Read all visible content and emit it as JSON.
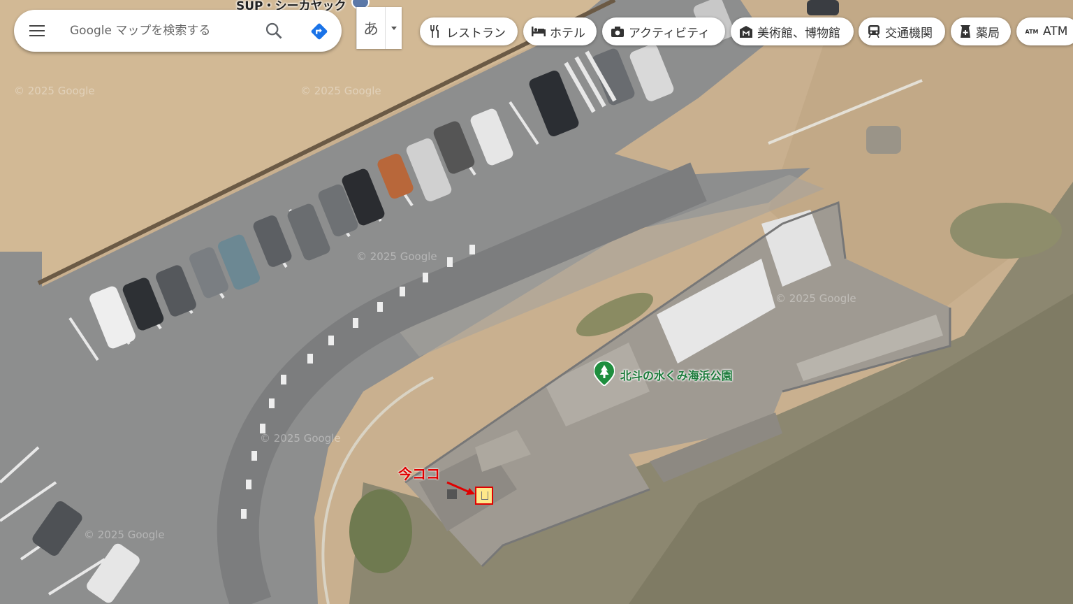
{
  "search": {
    "placeholder": "Google マップを検索する",
    "menu_icon": "hamburger-menu-icon",
    "search_icon": "magnifier-icon",
    "directions_icon": "directions-arrow-icon",
    "accent_color": "#1a73e8"
  },
  "ime": {
    "label": "あ"
  },
  "chips": [
    {
      "label": "レストラン",
      "icon": "restaurant-icon"
    },
    {
      "label": "ホテル",
      "icon": "hotel-bed-icon"
    },
    {
      "label": "アクティビティ",
      "icon": "camera-icon"
    },
    {
      "label": "美術館、博物館",
      "icon": "museum-icon"
    },
    {
      "label": "交通機関",
      "icon": "train-icon"
    },
    {
      "label": "薬局",
      "icon": "pharmacy-icon"
    },
    {
      "label": "ATM",
      "icon": "atm-icon"
    }
  ],
  "map": {
    "top_place_label": "SUP・シーカヤック",
    "park_label": "北斗の水くみ海浜公園",
    "park_pin_color": "#1e8e3e",
    "here_label": "今ココ",
    "annotation_color": "#e00000",
    "watermark": "© 2025 Google"
  }
}
